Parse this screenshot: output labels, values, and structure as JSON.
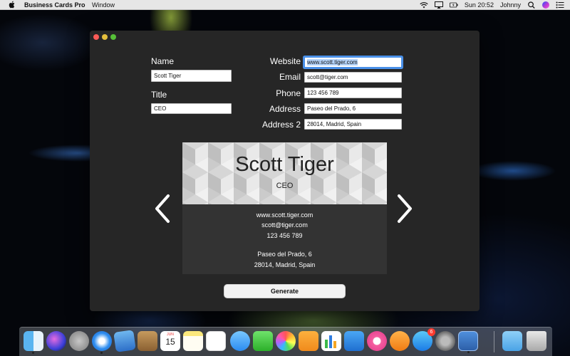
{
  "menubar": {
    "app_name": "Business Cards Pro",
    "menu_window": "Window",
    "clock": "Sun 20:52",
    "user": "Johnny"
  },
  "form": {
    "name_label": "Name",
    "name_value": "Scott Tiger",
    "title_label": "Title",
    "title_value": "CEO",
    "website_label": "Website",
    "website_value": "www.scott.tiger.com",
    "email_label": "Email",
    "email_value": "scott@tiger.com",
    "phone_label": "Phone",
    "phone_value": "123 456 789",
    "address_label": "Address",
    "address_value": "Paseo del Prado, 6",
    "address2_label": "Address 2",
    "address2_value": "28014, Madrid, Spain"
  },
  "card": {
    "name": "Scott Tiger",
    "title": "CEO",
    "website": "www.scott.tiger.com",
    "email": "scott@tiger.com",
    "phone": "123 456 789",
    "address": "Paseo del Prado, 6",
    "address2": "28014, Madrid, Spain"
  },
  "generate_label": "Generate",
  "dock": {
    "calendar_month": "JUN",
    "calendar_day": "15",
    "appstore_badge": "6",
    "items": [
      "finder-icon",
      "siri-icon",
      "launchpad-icon",
      "safari-icon",
      "mail-icon",
      "contacts-icon",
      "calendar-icon",
      "notes-icon",
      "reminders-icon",
      "messages-icon",
      "facetime-icon",
      "photos-icon",
      "pages-icon",
      "numbers-icon",
      "keynote-icon",
      "itunes-icon",
      "ibooks-icon",
      "app-store-icon",
      "system-preferences-icon",
      "business-cards-icon",
      "downloads-folder-icon",
      "trash-icon"
    ]
  }
}
